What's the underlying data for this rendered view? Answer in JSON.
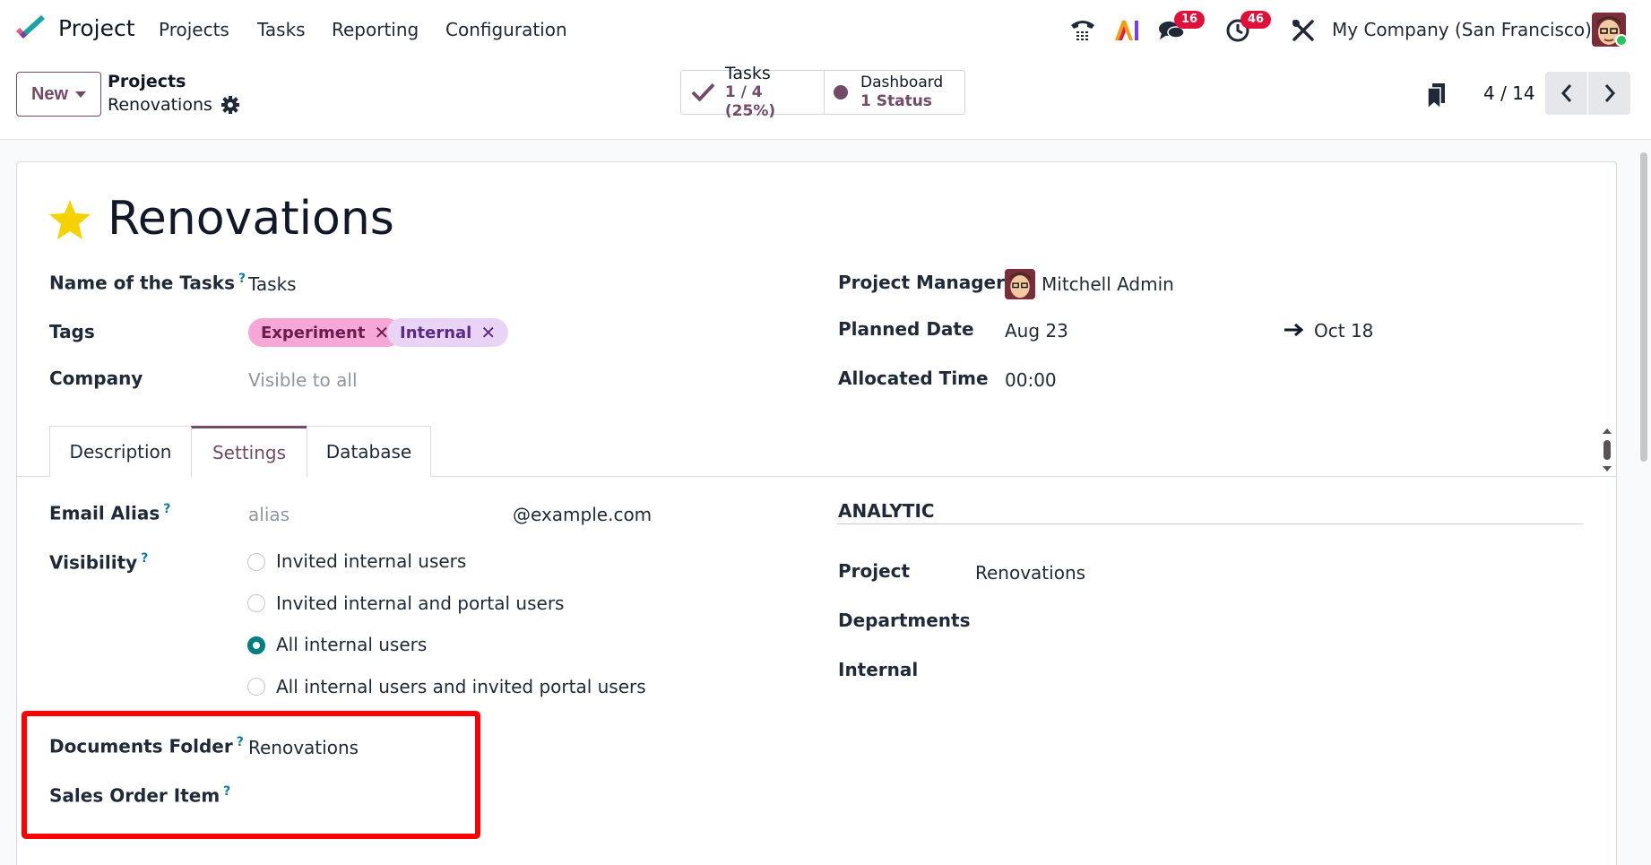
{
  "navbar": {
    "app_name": "Project",
    "menus": [
      "Projects",
      "Tasks",
      "Reporting",
      "Configuration"
    ],
    "icons": [
      "phone-icon",
      "ai-icon",
      "chat-icon",
      "activity-clock-icon",
      "debug-tools-icon"
    ],
    "chat_badge": "16",
    "activity_badge": "46",
    "company": "My Company (San Francisco)"
  },
  "control": {
    "new_label": "New",
    "breadcrumb_parent": "Projects",
    "breadcrumb_current": "Renovations",
    "tasks_title": "Tasks",
    "tasks_value": "1 / 4 (25%)",
    "dashboard_title": "Dashboard",
    "dashboard_value": "1 Status",
    "pager": "4 / 14"
  },
  "form": {
    "title": "Renovations",
    "name_tasks_label": "Name of the Tasks",
    "name_tasks_value": "Tasks",
    "tags_label": "Tags",
    "tags": [
      {
        "name": "Experiment",
        "bg": "#f7a6d8",
        "fg": "#6b1b4f"
      },
      {
        "name": "Internal",
        "bg": "#e9d4f5",
        "fg": "#5b2a86"
      }
    ],
    "company_label": "Company",
    "company_placeholder": "Visible to all",
    "pm_label": "Project Manager",
    "pm_value": "Mitchell Admin",
    "planned_label": "Planned Date",
    "planned_start": "Aug 23",
    "planned_end": "Oct 18",
    "allocated_label": "Allocated Time",
    "allocated_value": "00:00"
  },
  "tabs": [
    "Description",
    "Settings",
    "Database"
  ],
  "settings": {
    "email_alias_label": "Email Alias",
    "alias_placeholder": "alias",
    "alias_domain": "@example.com",
    "visibility_label": "Visibility",
    "visibility_options": [
      "Invited internal users",
      "Invited internal and portal users",
      "All internal users",
      "All internal users and invited portal users"
    ],
    "visibility_selected": "All internal users",
    "documents_folder_label": "Documents Folder",
    "documents_folder_value": "Renovations",
    "sales_order_item_label": "Sales Order Item",
    "analytic_heading": "ANALYTIC",
    "analytic_project_label": "Project",
    "analytic_project_value": "Renovations",
    "departments_label": "Departments",
    "internal_label": "Internal"
  },
  "colors": {
    "brand": "#714b67",
    "accent_radio": "#017e84",
    "badge": "#e0103a",
    "star": "#f5d200",
    "highlight": "#ff0000"
  }
}
